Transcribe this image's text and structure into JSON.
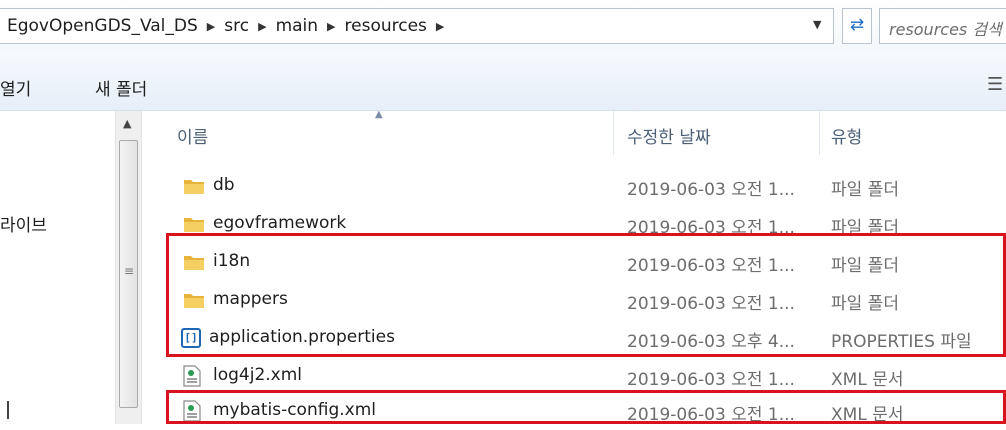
{
  "address_bar": {
    "breadcrumbs": [
      "EgovOpenGDS_Val_DS",
      "src",
      "main",
      "resources"
    ],
    "search_placeholder": "resources 검색"
  },
  "toolbar": {
    "open_label": "열기",
    "new_folder_label": "새 폴더"
  },
  "nav_pane": {
    "visible_label": "라이브"
  },
  "columns": {
    "name": "이름",
    "date": "수정한 날짜",
    "type": "유형"
  },
  "files": [
    {
      "name": "db",
      "date": "2019-06-03 오전 1...",
      "type": "파일 폴더",
      "icon": "folder-icon"
    },
    {
      "name": "egovframework",
      "date": "2019-06-03 오전 1...",
      "type": "파일 폴더",
      "icon": "folder-icon"
    },
    {
      "name": "i18n",
      "date": "2019-06-03 오전 1...",
      "type": "파일 폴더",
      "icon": "folder-icon"
    },
    {
      "name": "mappers",
      "date": "2019-06-03 오전 1...",
      "type": "파일 폴더",
      "icon": "folder-icon"
    },
    {
      "name": "application.properties",
      "date": "2019-06-03 오후 4...",
      "type": "PROPERTIES 파일",
      "icon": "properties-file-icon"
    },
    {
      "name": "log4j2.xml",
      "date": "2019-06-03 오전 1...",
      "type": "XML 문서",
      "icon": "xml-file-icon"
    },
    {
      "name": "mybatis-config.xml",
      "date": "2019-06-03 오전 1...",
      "type": "XML 문서",
      "icon": "xml-file-icon"
    }
  ],
  "colors": {
    "highlight_border": "#d8121f",
    "folder_yellow": "#e8b33a",
    "header_text": "#4c607a"
  }
}
